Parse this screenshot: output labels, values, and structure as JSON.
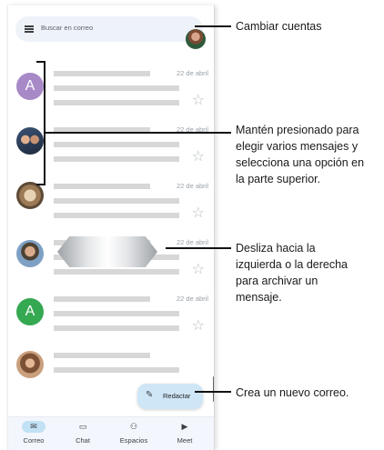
{
  "search": {
    "placeholder": "Buscar en correo",
    "menu_icon": "hamburger-menu-icon"
  },
  "emails": [
    {
      "avatar_letter": "A",
      "avatar_color": "#a889c7",
      "date": "22 de abril"
    },
    {
      "avatar_letter": "",
      "avatar_color": "",
      "date": "22 de abril"
    },
    {
      "avatar_letter": "",
      "avatar_color": "",
      "date": "22 de abril"
    },
    {
      "avatar_letter": "",
      "avatar_color": "",
      "date": "22 de abril"
    },
    {
      "avatar_letter": "A",
      "avatar_color": "#35a852",
      "date": "22 de abril"
    },
    {
      "avatar_letter": "",
      "avatar_color": "",
      "date": ""
    }
  ],
  "compose": {
    "label": "Redactar",
    "icon": "pencil-icon"
  },
  "bottom_nav": [
    {
      "label": "Correo",
      "icon": "mail-icon",
      "active": true
    },
    {
      "label": "Chat",
      "icon": "chat-icon",
      "active": false
    },
    {
      "label": "Espacios",
      "icon": "spaces-icon",
      "active": false
    },
    {
      "label": "Meet",
      "icon": "video-icon",
      "active": false
    }
  ],
  "callouts": {
    "switch_accounts": "Cambiar cuentas",
    "long_press": [
      "Mantén presionado para",
      "elegir varios mensajes y",
      "selecciona una opción en",
      "la parte superior."
    ],
    "swipe": [
      "Desliza hacia la",
      "izquierda o la derecha",
      "para archivar un",
      "mensaje."
    ],
    "compose": "Crea un nuevo correo."
  },
  "colors": {
    "accent": "#c2e1f5",
    "compose_bg": "#cfe6f7",
    "search_bg": "#eef2f9"
  }
}
